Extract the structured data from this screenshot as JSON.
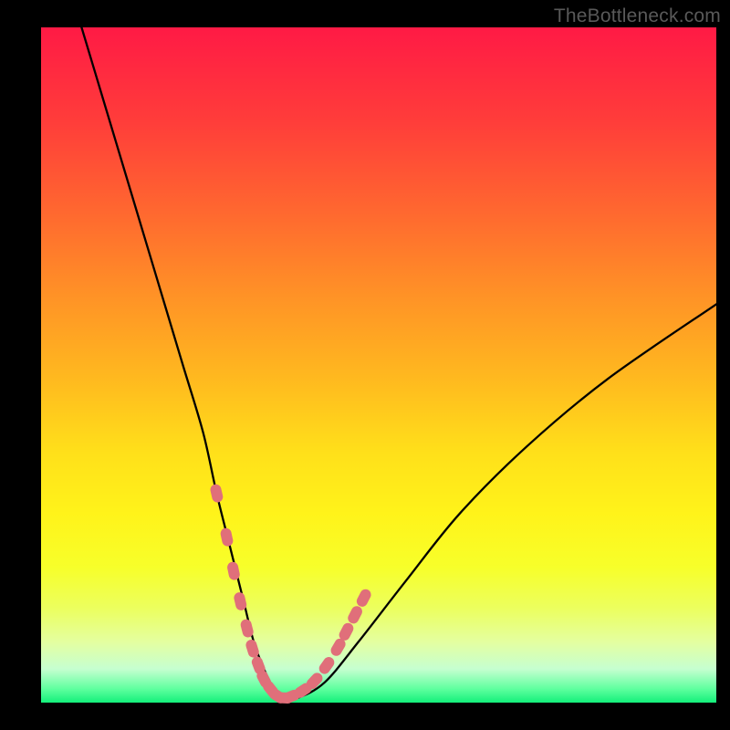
{
  "watermark": "TheBottleneck.com",
  "chart_data": {
    "type": "line",
    "title": "",
    "xlabel": "",
    "ylabel": "",
    "xlim": [
      0,
      100
    ],
    "ylim": [
      0,
      100
    ],
    "series": [
      {
        "name": "bottleneck-curve",
        "x": [
          6,
          9,
          12,
          15,
          18,
          21,
          24,
          26,
          28,
          30,
          31.5,
          33,
          34.5,
          36,
          38,
          42,
          47,
          54,
          62,
          72,
          84,
          100
        ],
        "y": [
          100,
          90,
          80,
          70,
          60,
          50,
          40,
          31,
          23,
          15,
          9,
          5,
          2,
          0.7,
          0.7,
          3,
          9,
          18,
          28,
          38,
          48,
          59
        ]
      }
    ],
    "markers": {
      "name": "highlighted-points",
      "color": "#e06f7a",
      "x": [
        26.0,
        27.5,
        28.5,
        29.5,
        30.5,
        31.3,
        32.2,
        33.0,
        34.0,
        35.0,
        36.0,
        37.0,
        38.8,
        40.5,
        42.3,
        44.0,
        45.2,
        46.5,
        47.8
      ],
      "y": [
        31.0,
        24.5,
        19.5,
        15.0,
        11.0,
        8.0,
        5.5,
        3.5,
        2.0,
        1.0,
        0.7,
        0.9,
        1.8,
        3.2,
        5.5,
        8.2,
        10.5,
        13.0,
        15.5
      ]
    }
  },
  "colors": {
    "curve": "#000000",
    "marker_fill": "#e06f7a",
    "marker_stroke": "#d85e6a"
  }
}
